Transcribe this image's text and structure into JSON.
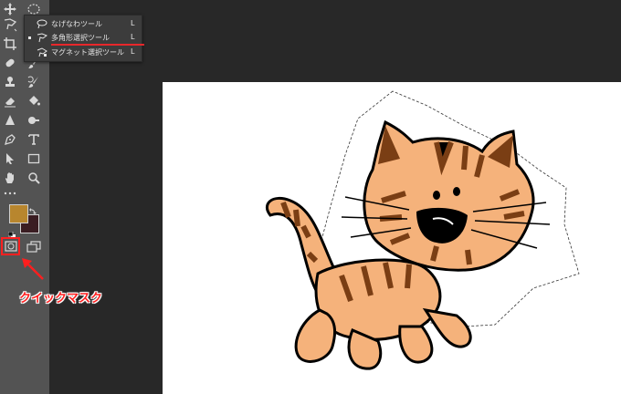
{
  "flyout": {
    "items": [
      {
        "label": "なげなわツール",
        "shortcut": "L",
        "icon": "lasso-icon",
        "active": false
      },
      {
        "label": "多角形選択ツール",
        "shortcut": "L",
        "icon": "polygonal-lasso-icon",
        "active": true
      },
      {
        "label": "マグネット選択ツール",
        "shortcut": "L",
        "icon": "magnetic-lasso-icon",
        "active": false
      }
    ]
  },
  "annotation": {
    "label": "クイックマスク",
    "color": "#ff1f1f"
  },
  "colors": {
    "foreground": "#b8862e",
    "background": "#3a1d22",
    "toolbar": "#535353",
    "workspace": "#282828",
    "highlight_underline": "#e8272b"
  },
  "tools": [
    "move-icon",
    "marquee-ellipse-icon",
    "lasso-icon",
    "crop-icon",
    "eyedropper-icon",
    "healing-brush-icon",
    "brush-icon",
    "clone-stamp-icon",
    "history-brush-icon",
    "eraser-icon",
    "paint-bucket-icon",
    "blur-icon",
    "dodge-icon",
    "pen-icon",
    "type-icon",
    "path-selection-icon",
    "rectangle-icon",
    "hand-icon",
    "zoom-icon",
    "more-icon",
    "quick-mask-icon",
    "screen-mode-icon"
  ]
}
